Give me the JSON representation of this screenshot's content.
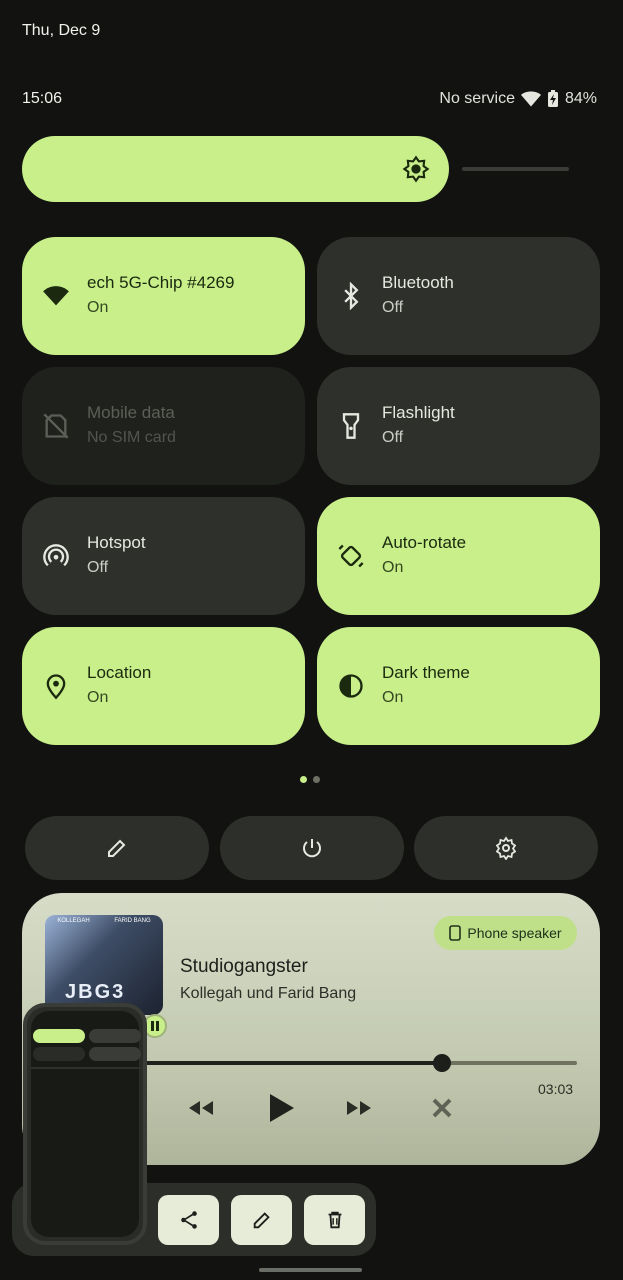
{
  "status_bar": {
    "date": "Thu, Dec 9",
    "time": "15:06",
    "service": "No service",
    "battery": "84%"
  },
  "brightness": {
    "level": 0.78
  },
  "tiles": [
    {
      "title": "ech 5G-Chip #4269",
      "subtitle": "On",
      "state": "on",
      "icon": "wifi-icon"
    },
    {
      "title": "Bluetooth",
      "subtitle": "Off",
      "state": "off",
      "icon": "bluetooth-icon"
    },
    {
      "title": "Mobile data",
      "subtitle": "No SIM card",
      "state": "disabled",
      "icon": "no-sim-icon"
    },
    {
      "title": "Flashlight",
      "subtitle": "Off",
      "state": "off",
      "icon": "flashlight-icon"
    },
    {
      "title": "Hotspot",
      "subtitle": "Off",
      "state": "off",
      "icon": "hotspot-icon"
    },
    {
      "title": "Auto-rotate",
      "subtitle": "On",
      "state": "on",
      "icon": "auto-rotate-icon"
    },
    {
      "title": "Location",
      "subtitle": "On",
      "state": "on",
      "icon": "location-icon"
    },
    {
      "title": "Dark theme",
      "subtitle": "On",
      "state": "on",
      "icon": "dark-theme-icon"
    }
  ],
  "page_indicator": {
    "pages": 2,
    "current": 1
  },
  "bottom_buttons": [
    "edit-icon",
    "power-icon",
    "settings-icon"
  ],
  "media": {
    "song": "Studiogangster",
    "artist": "Kollegah und Farid Bang",
    "output": "Phone speaker",
    "duration": "03:03",
    "progress": 0.69,
    "album_text_left": "KOLLEGAH",
    "album_text_right": "FARID BANG",
    "album_logo": "JBG3"
  },
  "screenshot_actions": [
    "share-icon",
    "edit-icon",
    "delete-icon"
  ],
  "colors": {
    "accent": "#c8ef8a",
    "tile_off": "#2e302c",
    "background": "#121311"
  }
}
